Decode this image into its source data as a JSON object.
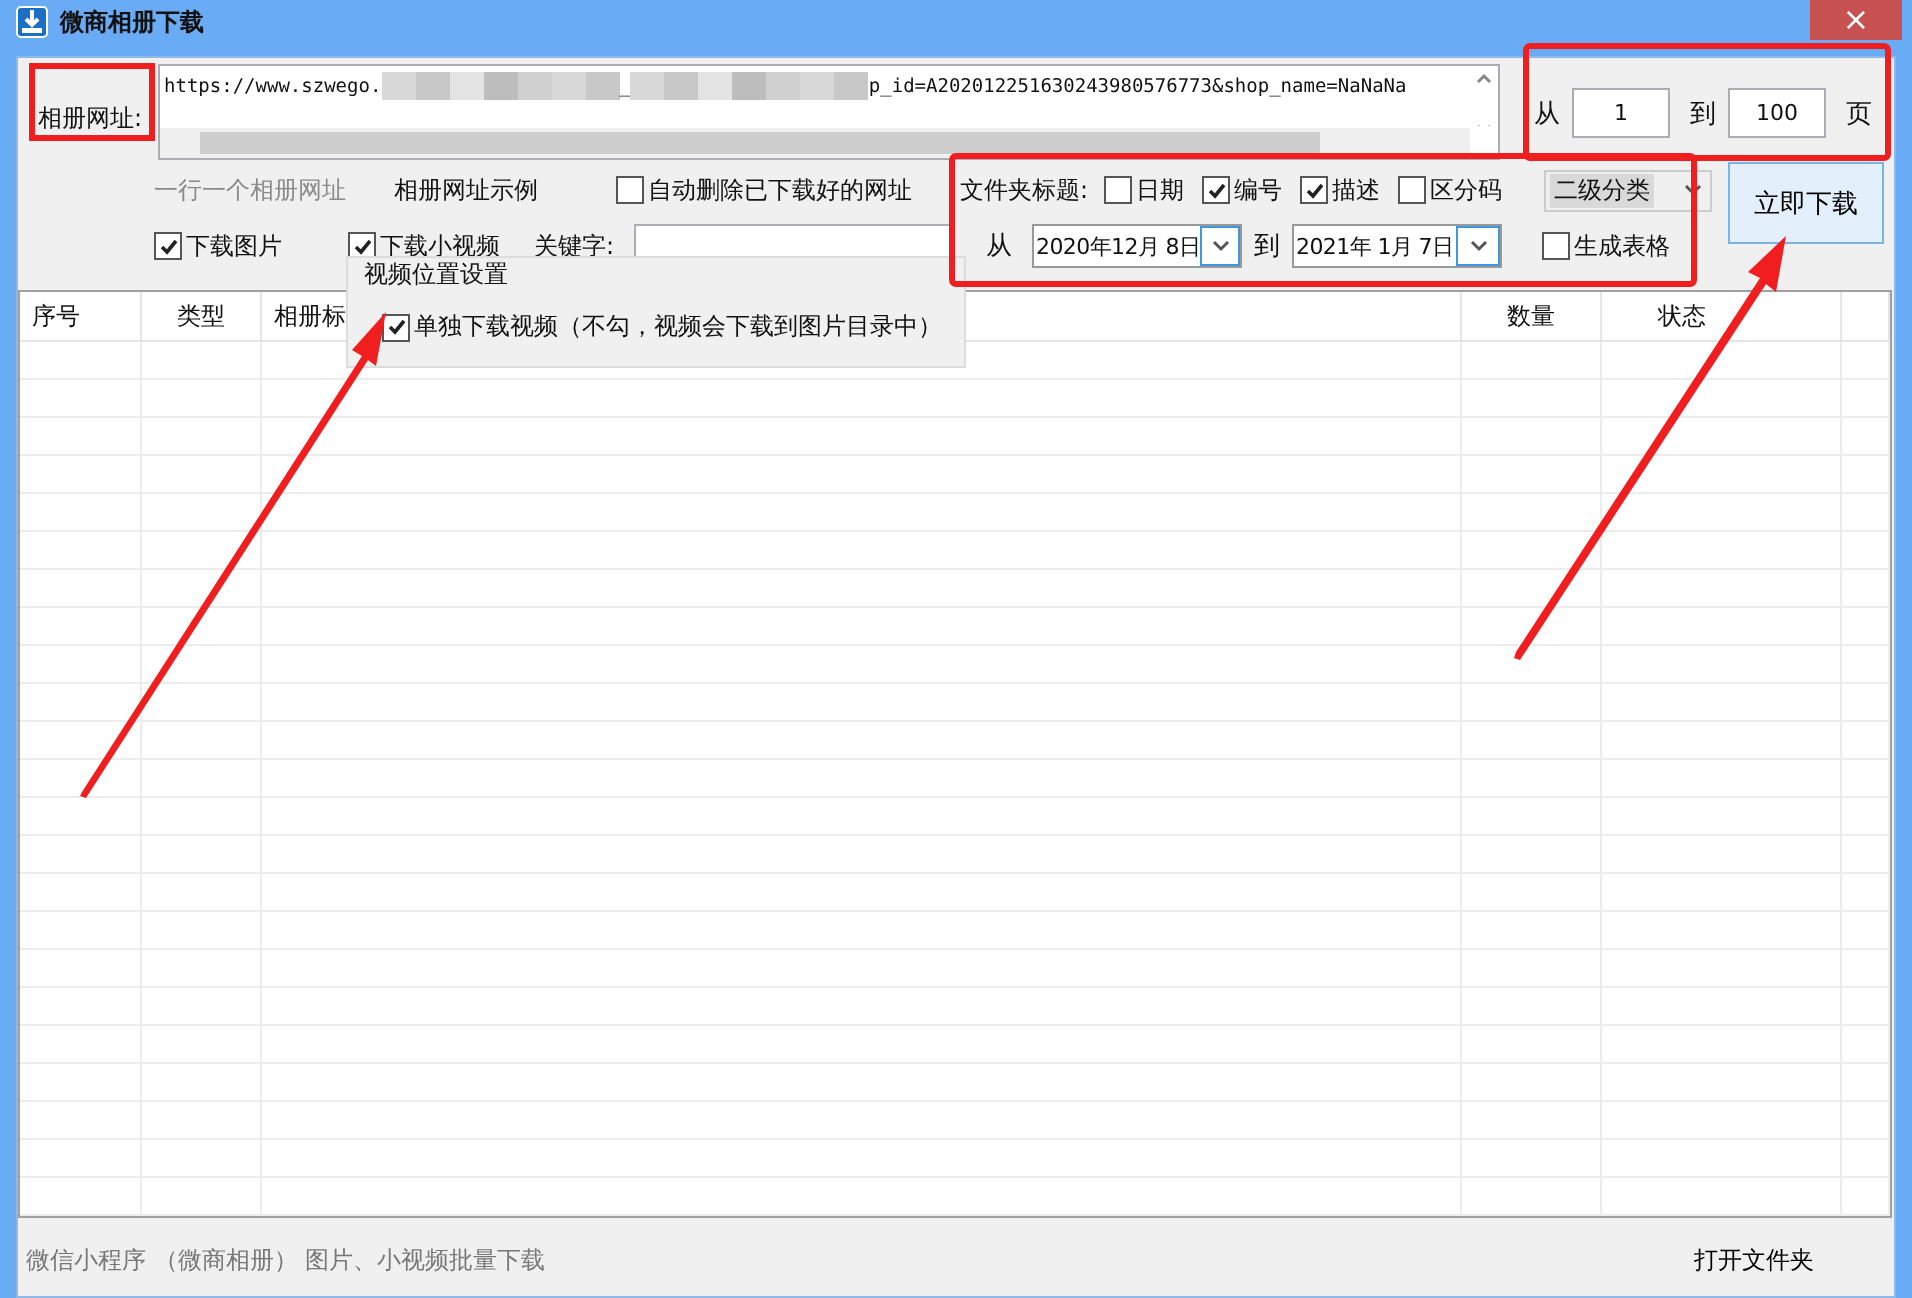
{
  "window": {
    "title": "微商相册下载",
    "close": "×"
  },
  "url_field": {
    "label": "相册网址:",
    "segments": [
      {
        "kind": "text",
        "text": "https://www.szwego."
      },
      {
        "kind": "blur"
      },
      {
        "kind": "text",
        "text": "_"
      },
      {
        "kind": "blur"
      },
      {
        "kind": "text",
        "text": "p_id=A202012251630243980576773&shop_name=NaNaNa"
      }
    ]
  },
  "url_hint": "一行一个相册网址",
  "example_link": "相册网址示例",
  "auto_delete": {
    "label": "自动删除已下载好的网址",
    "checked": false
  },
  "page_range": {
    "from_label": "从",
    "from": "1",
    "to_label": "到",
    "to": "100",
    "unit": "页"
  },
  "folder_title": {
    "label": "文件夹标题:",
    "options": [
      {
        "label": "日期",
        "checked": false
      },
      {
        "label": "编号",
        "checked": true
      },
      {
        "label": "描述",
        "checked": true
      },
      {
        "label": "区分码",
        "checked": false
      }
    ]
  },
  "category_select": {
    "value": "二级分类"
  },
  "download_options": [
    {
      "label": "下载图片",
      "checked": true
    },
    {
      "label": "下载小视频",
      "checked": true
    }
  ],
  "keyword": {
    "label": "关键字:"
  },
  "date_range": {
    "from_label": "从",
    "from": "2020年12月 8日",
    "to_label": "到",
    "to": "2021年 1月 7日"
  },
  "generate_table": {
    "label": "生成表格",
    "checked": false
  },
  "download_button": "立即下载",
  "table": {
    "columns": [
      "序号",
      "类型",
      "相册标",
      "数量",
      "状态"
    ]
  },
  "popup": {
    "title": "视频位置设置",
    "option": {
      "label": "单独下载视频（不勾，视频会下载到图片目录中）",
      "checked": true
    }
  },
  "footer": {
    "note": "微信小程序 （微商相册） 图片、小视频批量下载",
    "open_folder": "打开文件夹"
  }
}
